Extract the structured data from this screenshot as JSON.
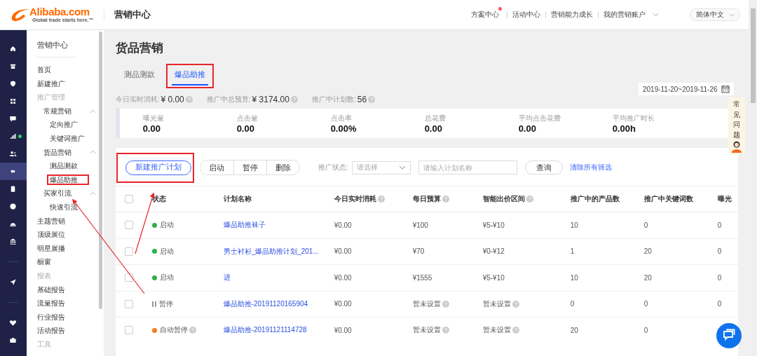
{
  "header": {
    "brand": "Alibaba.com",
    "tagline": "Global trade starts here.™",
    "title": "营销中心",
    "nav": [
      {
        "label": "方案中心",
        "badge": true,
        "dropdown": false
      },
      {
        "label": "活动中心",
        "badge": false,
        "dropdown": false
      },
      {
        "label": "营销能力成长",
        "badge": false,
        "dropdown": false
      },
      {
        "label": "我的营销账户",
        "badge": false,
        "dropdown": true
      }
    ],
    "language": "简体中文"
  },
  "rail": [
    {
      "kind": "home",
      "selected": false,
      "dot": false
    },
    {
      "kind": "store",
      "selected": false,
      "dot": false
    },
    {
      "kind": "shield",
      "selected": false,
      "dot": false
    },
    {
      "kind": "grid",
      "selected": false,
      "dot": false
    },
    {
      "kind": "chat",
      "selected": false,
      "dot": false
    },
    {
      "kind": "chart",
      "selected": false,
      "dot": true
    },
    {
      "kind": "users",
      "selected": false,
      "dot": false
    },
    {
      "kind": "share",
      "selected": true,
      "dot": false
    },
    {
      "kind": "clipboard",
      "selected": false,
      "dot": false
    },
    {
      "kind": "globe",
      "selected": false,
      "dot": false
    },
    {
      "kind": "hat",
      "selected": false,
      "dot": false
    },
    {
      "kind": "bank",
      "selected": false,
      "dot": false
    },
    {
      "kind": "divider"
    },
    {
      "kind": "send",
      "selected": false,
      "dot": false
    },
    {
      "kind": "divider"
    },
    {
      "kind": "heart",
      "selected": false,
      "dot": false
    },
    {
      "kind": "briefcase",
      "selected": false,
      "dot": false
    }
  ],
  "sidebar": {
    "title": "营销中心",
    "items": [
      {
        "kind": "link",
        "label": "首页"
      },
      {
        "kind": "link",
        "label": "新建推广"
      },
      {
        "kind": "heading",
        "label": "推广管理"
      },
      {
        "kind": "group",
        "label": "常规营销",
        "expanded": true,
        "children": [
          {
            "label": "定向推广",
            "highlighted": false
          },
          {
            "label": "关键词推广",
            "highlighted": false
          }
        ]
      },
      {
        "kind": "group",
        "label": "货品营销",
        "expanded": true,
        "children": [
          {
            "label": "测品测款",
            "highlighted": false
          },
          {
            "label": "爆品助推",
            "highlighted": true
          }
        ]
      },
      {
        "kind": "group",
        "label": "买家引流",
        "expanded": true,
        "children": [
          {
            "label": "快速引流",
            "highlighted": false
          }
        ]
      },
      {
        "kind": "link",
        "label": "主题营销"
      },
      {
        "kind": "link",
        "label": "顶级展位"
      },
      {
        "kind": "link",
        "label": "明星展播"
      },
      {
        "kind": "link",
        "label": "橱窗"
      },
      {
        "kind": "heading",
        "label": "报表"
      },
      {
        "kind": "link",
        "label": "基础报告"
      },
      {
        "kind": "link",
        "label": "流量报告"
      },
      {
        "kind": "link",
        "label": "行业报告"
      },
      {
        "kind": "link",
        "label": "活动报告"
      },
      {
        "kind": "heading",
        "label": "工具"
      }
    ]
  },
  "page": {
    "title": "货品营销",
    "tabs": [
      {
        "label": "测品测款",
        "selected": false,
        "highlighted": false
      },
      {
        "label": "爆品助推",
        "selected": true,
        "highlighted": true
      }
    ],
    "date_range": "2019-11-20~2019-11-26",
    "summary": [
      {
        "label": "今日实时消耗:",
        "value": "¥ 0.00"
      },
      {
        "label": "推广中总预算:",
        "value": "¥ 3174.00"
      },
      {
        "label": "推广中计划数:",
        "value": "56"
      }
    ],
    "metrics": [
      {
        "label": "曝光量",
        "value": "0.00"
      },
      {
        "label": "点击量",
        "value": "0.00"
      },
      {
        "label": "点击率",
        "value": "0.00%"
      },
      {
        "label": "总花费",
        "value": "0.00"
      },
      {
        "label": "平均点击花费",
        "value": "0.00"
      },
      {
        "label": "平均推广时长",
        "value": "0.00h"
      }
    ]
  },
  "toolbar": {
    "new_plan": {
      "label": "新建推广计划",
      "highlighted": true
    },
    "actions": [
      "启动",
      "暂停",
      "删除"
    ],
    "status_filter": {
      "label": "推广状态:",
      "placeholder": "请选择"
    },
    "search": {
      "placeholder": "请输入计划名称"
    },
    "query": "查询",
    "clear": "清除所有筛选"
  },
  "table": {
    "select_all": false,
    "columns": [
      {
        "label": "状态",
        "help": false
      },
      {
        "label": "计划名称",
        "help": false
      },
      {
        "label": "今日实时消耗",
        "help": true
      },
      {
        "label": "每日预算",
        "help": true
      },
      {
        "label": "智能出价区间",
        "help": true
      },
      {
        "label": "推广中的产品数",
        "help": false
      },
      {
        "label": "推广中关键词数",
        "help": false
      },
      {
        "label": "曝光",
        "help": false
      }
    ],
    "rows": [
      {
        "checked": false,
        "cells": [
          {
            "kind": "running",
            "text": "启动",
            "help": false
          },
          {
            "kind": "link",
            "text": "爆品助推袜子",
            "help": false
          },
          {
            "kind": "text",
            "text": "¥0.00",
            "help": false
          },
          {
            "kind": "text",
            "text": "¥100",
            "help": false
          },
          {
            "kind": "text",
            "text": "¥5-¥10",
            "help": false
          },
          {
            "kind": "text",
            "text": "10",
            "help": false
          },
          {
            "kind": "text",
            "text": "0",
            "help": false
          },
          {
            "kind": "text",
            "text": "0",
            "help": false
          }
        ]
      },
      {
        "checked": false,
        "cells": [
          {
            "kind": "running",
            "text": "启动",
            "help": false
          },
          {
            "kind": "link",
            "text": "男士衬衫_爆品助推计划_201...",
            "help": false
          },
          {
            "kind": "text",
            "text": "¥0.00",
            "help": false
          },
          {
            "kind": "text",
            "text": "¥70",
            "help": false
          },
          {
            "kind": "text",
            "text": "¥0-¥12",
            "help": false
          },
          {
            "kind": "text",
            "text": "1",
            "help": false
          },
          {
            "kind": "text",
            "text": "20",
            "help": false
          },
          {
            "kind": "text",
            "text": "0",
            "help": false
          }
        ]
      },
      {
        "checked": false,
        "cells": [
          {
            "kind": "running",
            "text": "启动",
            "help": false
          },
          {
            "kind": "link",
            "text": "进",
            "help": false
          },
          {
            "kind": "text",
            "text": "¥0.00",
            "help": false
          },
          {
            "kind": "text",
            "text": "¥1555",
            "help": false
          },
          {
            "kind": "text",
            "text": "¥5-¥10",
            "help": false
          },
          {
            "kind": "text",
            "text": "10",
            "help": false
          },
          {
            "kind": "text",
            "text": "20",
            "help": false
          },
          {
            "kind": "text",
            "text": "0",
            "help": false
          }
        ]
      },
      {
        "checked": false,
        "cells": [
          {
            "kind": "paused",
            "text": "暂停",
            "help": false
          },
          {
            "kind": "link",
            "text": "爆品助推-20191120165904",
            "help": false
          },
          {
            "kind": "text",
            "text": "¥0.00",
            "help": false
          },
          {
            "kind": "text",
            "text": "暂未设置",
            "help": true
          },
          {
            "kind": "text",
            "text": "暂未设置",
            "help": true
          },
          {
            "kind": "text",
            "text": "0",
            "help": false
          },
          {
            "kind": "text",
            "text": "0",
            "help": false
          },
          {
            "kind": "text",
            "text": "0",
            "help": false
          }
        ]
      },
      {
        "checked": false,
        "cells": [
          {
            "kind": "auto_paused",
            "text": "自动暂停",
            "help": true
          },
          {
            "kind": "link",
            "text": "爆品助推-20191121114728",
            "help": false
          },
          {
            "kind": "text",
            "text": "¥0.00",
            "help": false
          },
          {
            "kind": "text",
            "text": "暂未设置",
            "help": true
          },
          {
            "kind": "text",
            "text": "暂未设置",
            "help": true
          },
          {
            "kind": "text",
            "text": "20",
            "help": false
          },
          {
            "kind": "text",
            "text": "0",
            "help": false
          }
        ]
      }
    ]
  },
  "help_float": {
    "label": "常见问题"
  }
}
